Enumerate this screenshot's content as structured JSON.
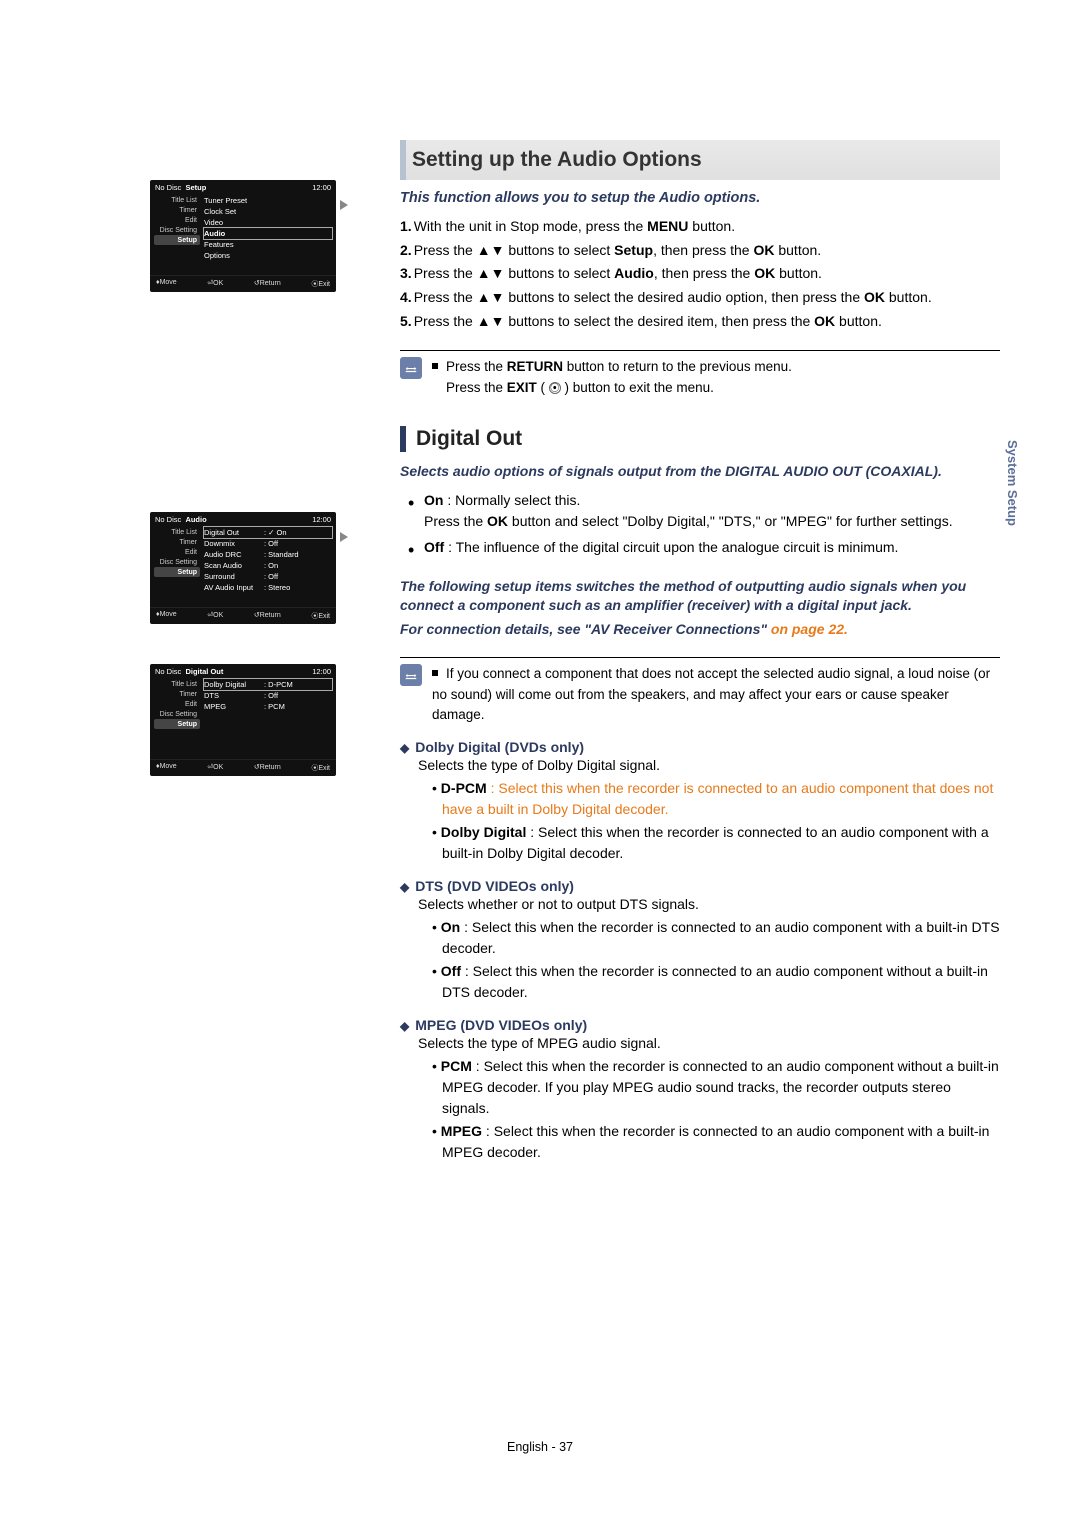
{
  "headings": {
    "main": "Setting up the Audio Options",
    "sub": "Digital Out"
  },
  "intro": "This function allows you to setup the Audio options.",
  "steps": [
    {
      "n": "1.",
      "pre": "With the unit in Stop mode, press the ",
      "b": "MENU",
      "post": " button."
    },
    {
      "n": "2.",
      "pre": "Press the ▲▼ buttons to select ",
      "b": "Setup",
      "post": ", then press the ",
      "b2": "OK",
      "post2": " button."
    },
    {
      "n": "3.",
      "pre": "Press the ▲▼ buttons to select ",
      "b": "Audio",
      "post": ", then press the ",
      "b2": "OK",
      "post2": " button."
    },
    {
      "n": "4.",
      "pre": "Press the ▲▼ buttons to select the desired audio option, then press the ",
      "b": "OK",
      "post": " button."
    },
    {
      "n": "5.",
      "pre": "Press the ▲▼ buttons to select the desired item, then press the ",
      "b": "OK",
      "post": " button."
    }
  ],
  "return_note_line1_pre": "Press the ",
  "return_note_line1_b": "RETURN",
  "return_note_line1_post": " button to return to the previous menu.",
  "return_note_line2_pre": "Press the ",
  "return_note_line2_b": "EXIT",
  "return_note_line2_post": " button to exit the menu.",
  "digital_out_desc": "Selects audio options of signals output from the DIGITAL AUDIO OUT (COAXIAL).",
  "on_label": "On",
  "on_text1": " : Normally select this.",
  "on_text2_pre": "Press the ",
  "on_text2_b": "OK",
  "on_text2_post": " button and select \"Dolby Digital,\" \"DTS,\" or \"MPEG\" for further settings.",
  "off_label": "Off",
  "off_text": " : The influence of the digital circuit upon the analogue circuit is minimum.",
  "switch_para1": "The following setup items switches the method of outputting audio signals when you connect a component such as an amplifier (receiver) with a digital input jack.",
  "switch_para2_pre": "For connection details, see \"AV Receiver Connections\" ",
  "switch_para2_link": "on page 22.",
  "warn_note": "If you connect a component that does not accept the selected audio signal, a loud noise (or no sound) will come out from the speakers, and may affect your ears or cause speaker damage.",
  "dolby": {
    "head": "Dolby Digital (DVDs only)",
    "desc": "Selects the type of Dolby Digital signal.",
    "dpcm_label": "D-PCM",
    "dpcm_text": " : Select this when the recorder is connected to an audio component that does not have a built in Dolby Digital decoder.",
    "dd_label": "Dolby Digital",
    "dd_text": " : Select this when the recorder is connected to an audio component with a built-in Dolby Digital decoder."
  },
  "dts": {
    "head": "DTS (DVD VIDEOs only)",
    "desc": "Selects whether or not to output DTS signals.",
    "on_label": "On",
    "on_text": " : Select this when the recorder is connected to an audio component with a built-in DTS decoder.",
    "off_label": "Off",
    "off_text": " : Select this when the recorder is connected to an audio component without a built-in DTS decoder."
  },
  "mpeg": {
    "head": "MPEG (DVD VIDEOs only)",
    "desc": "Selects the type of MPEG audio signal.",
    "pcm_label": "PCM",
    "pcm_text": " : Select this when the recorder is connected to an audio component without a built-in MPEG decoder. If you play MPEG audio sound tracks, the recorder outputs stereo signals.",
    "mp_label": "MPEG",
    "mp_text": " : Select this when the recorder is connected to an audio component with a built-in MPEG decoder."
  },
  "screen_footer": {
    "move": "Move",
    "ok": "OK",
    "return": "Return",
    "exit": "Exit"
  },
  "screen1": {
    "disc": "No Disc",
    "title": "Setup",
    "time": "12:00",
    "sidebar": [
      "Title List",
      "Timer",
      "Edit",
      "Disc Setting",
      "Setup"
    ],
    "items": [
      "Tuner Preset",
      "Clock Set",
      "Video",
      "Audio",
      "Features",
      "Options"
    ]
  },
  "screen2": {
    "disc": "No Disc",
    "title": "Audio",
    "time": "12:00",
    "sidebar": [
      "Title List",
      "Timer",
      "Edit",
      "Disc Setting",
      "Setup"
    ],
    "rows": [
      {
        "l": "Digital Out",
        "v": ": ✓ On"
      },
      {
        "l": "Downmix",
        "v": ":   Off"
      },
      {
        "l": "Audio DRC",
        "v": ": Standard"
      },
      {
        "l": "Scan Audio",
        "v": ": On"
      },
      {
        "l": "Surround",
        "v": ": Off"
      },
      {
        "l": "AV Audio Input",
        "v": ": Stereo"
      }
    ]
  },
  "screen3": {
    "disc": "No Disc",
    "title": "Digital Out",
    "time": "12:00",
    "sidebar": [
      "Title List",
      "Timer",
      "Edit",
      "Disc Setting",
      "Setup"
    ],
    "rows": [
      {
        "l": "Dolby Digital",
        "v": ": D-PCM"
      },
      {
        "l": "DTS",
        "v": ": Off"
      },
      {
        "l": "MPEG",
        "v": ": PCM"
      }
    ]
  },
  "side_tab": "System Setup",
  "footer": "English - 37"
}
